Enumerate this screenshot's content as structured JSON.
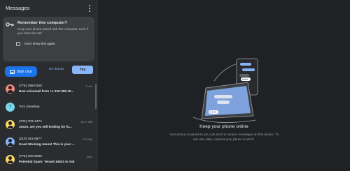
{
  "app": {
    "title": "Messages"
  },
  "remember": {
    "title": "Remember this computer?",
    "description": "Keep your phone paired with this computer, even if you close this tab",
    "checkbox_label": "Don't show this again",
    "no_thanks_label": "No thanks",
    "yes_label": "Yes"
  },
  "start_chat": {
    "label": "Start chat"
  },
  "conversations": [
    {
      "name": "(775) 399-0250",
      "snippet": "New voicemail from +1 310-399-10...",
      "time": "2 min",
      "avatar_color": "#f28b82",
      "initial": ""
    },
    {
      "name": "Tom Sheehan",
      "snippet": "",
      "time": "",
      "avatar_color": "#78d9ec",
      "initial": "T"
    },
    {
      "name": "(732) 703-4474",
      "snippet": "Jason, are you still looking for fu...",
      "time": "10:17 AM",
      "avatar_color": "#fdd663",
      "initial": ""
    },
    {
      "name": "(210) 451-8677",
      "snippet": "Good Morning Jason! This is your ...",
      "time": "7:51 AM",
      "avatar_color": "#8ab4f8",
      "initial": ""
    },
    {
      "name": "(775) 300-6299",
      "snippet": "Potential Spam: Tenant:15631 is risk ...",
      "time": "Mon",
      "avatar_color": "#fdd663",
      "initial": ""
    }
  ],
  "main": {
    "title": "Keep your phone online",
    "description": "Your phone is paired so you can send & receive messages on this device. To use less data, connect your phone to Wi-Fi."
  },
  "colors": {
    "accent": "#8ab4f8",
    "primary_button": "#1a73e8",
    "sidebar_bg": "#2b2c30",
    "main_bg": "#202124"
  }
}
